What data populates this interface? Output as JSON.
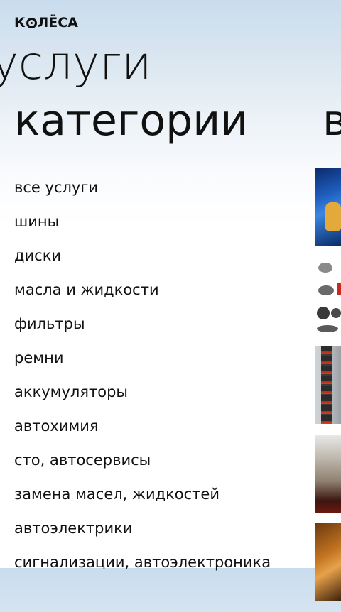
{
  "app": {
    "logo_text_before": "К",
    "logo_text_after": "ЛЁСА"
  },
  "panorama": {
    "title": "услуги"
  },
  "pivot": {
    "current": "категории",
    "next": "в"
  },
  "categories": [
    "все услуги",
    "шины",
    "диски",
    "масла и жидкости",
    "фильтры",
    "ремни",
    "аккумуляторы",
    "автохимия",
    "сто, автосервисы",
    "замена масел, жидкостей",
    "автоэлектрики",
    "сигнализации, автоэлектроника"
  ]
}
